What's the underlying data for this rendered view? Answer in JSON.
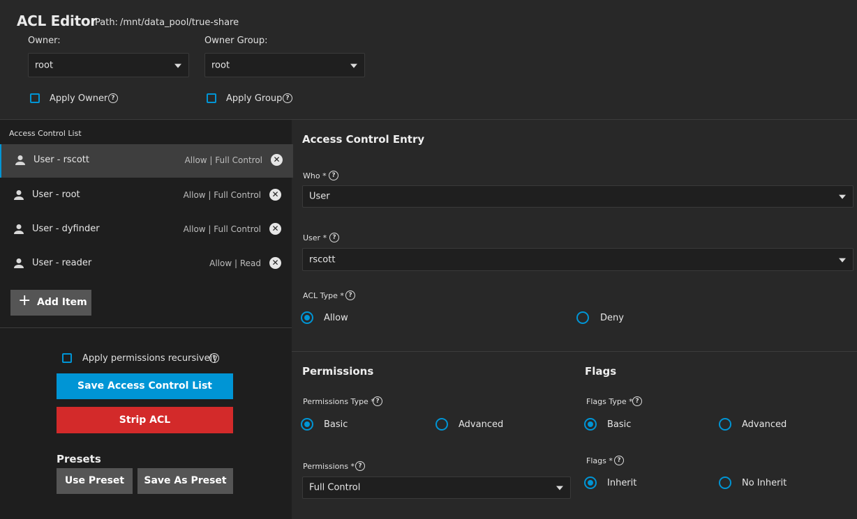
{
  "header": {
    "title": "ACL Editor",
    "path_label": "Path:",
    "path_value": "/mnt/data_pool/true-share"
  },
  "owner": {
    "label": "Owner:",
    "value": "root",
    "apply_label": "Apply Owner"
  },
  "owner_group": {
    "label": "Owner Group:",
    "value": "root",
    "apply_label": "Apply Group"
  },
  "acl_list": {
    "title": "Access Control List",
    "items": [
      {
        "label": "User - rscott",
        "status": "Allow | Full Control"
      },
      {
        "label": "User - root",
        "status": "Allow | Full Control"
      },
      {
        "label": "User - dyfinder",
        "status": "Allow | Full Control"
      },
      {
        "label": "User - reader",
        "status": "Allow | Read"
      }
    ],
    "add_item_label": "Add Item"
  },
  "actions": {
    "recursive_label": "Apply permissions recursively",
    "save_label": "Save Access Control List",
    "strip_label": "Strip ACL",
    "presets_title": "Presets",
    "use_preset_label": "Use Preset",
    "save_as_preset_label": "Save As Preset"
  },
  "entry": {
    "title": "Access Control Entry",
    "who_label": "Who *",
    "who_value": "User",
    "user_label": "User *",
    "user_value": "rscott",
    "acl_type_label": "ACL Type *",
    "acl_type_options": [
      "Allow",
      "Deny"
    ],
    "acl_type_selected": "Allow"
  },
  "permissions": {
    "title": "Permissions",
    "type_label": "Permissions Type *",
    "type_options": [
      "Basic",
      "Advanced"
    ],
    "type_selected": "Basic",
    "perm_label": "Permissions *",
    "perm_value": "Full Control"
  },
  "flags": {
    "title": "Flags",
    "type_label": "Flags Type *",
    "type_options": [
      "Basic",
      "Advanced"
    ],
    "type_selected": "Basic",
    "flags_label": "Flags *",
    "flags_options": [
      "Inherit",
      "No Inherit"
    ],
    "flags_selected": "Inherit"
  },
  "colors": {
    "accent": "#0095d5",
    "danger": "#d32a2a",
    "panel": "#1e1e1e",
    "background": "#282828"
  }
}
